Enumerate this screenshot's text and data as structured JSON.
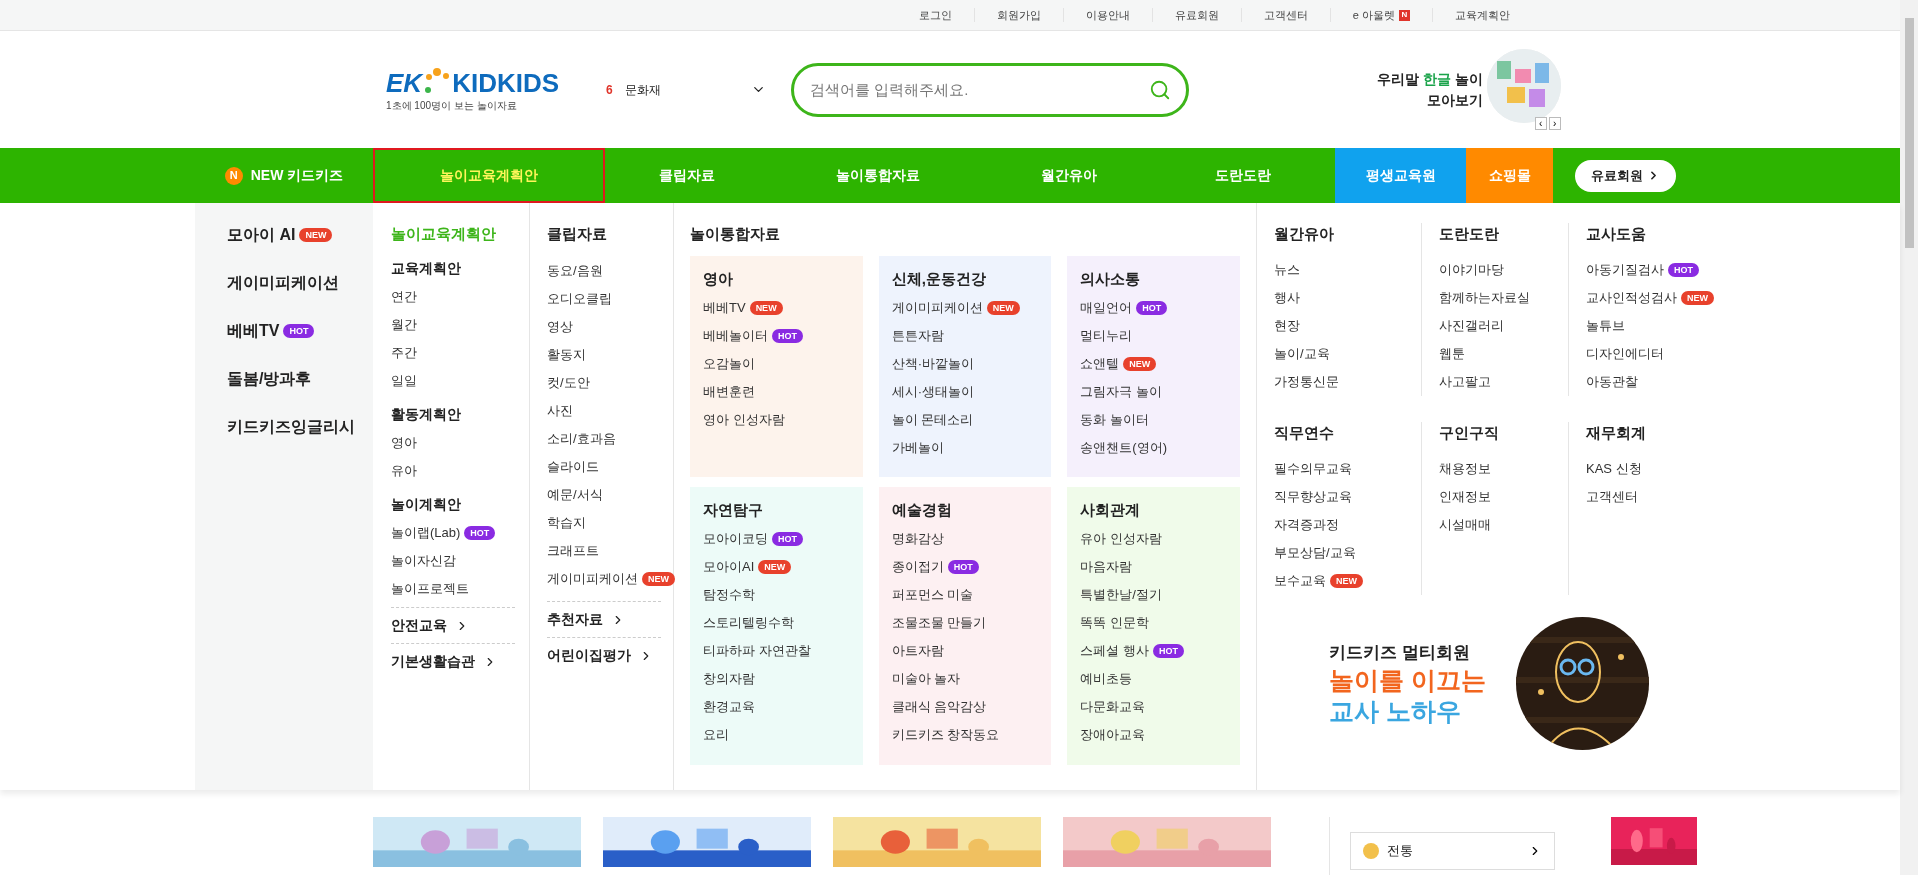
{
  "top_links": [
    {
      "label": "로그인"
    },
    {
      "label": "회원가입"
    },
    {
      "label": "이용안내"
    },
    {
      "label": "유료회원"
    },
    {
      "label": "고객센터"
    },
    {
      "label": "e 아울렛",
      "mark": "N"
    },
    {
      "label": "교육계획안"
    }
  ],
  "header": {
    "logo": {
      "prefix": "EK",
      "name": "KIDKIDS",
      "tagline": "1초에 100명이 보는 놀이자료"
    },
    "ranking": {
      "rank": "6",
      "keyword": "문화재"
    },
    "search": {
      "placeholder": "검색어를 입력해주세요."
    },
    "promo": {
      "before": "우리말",
      "highlight": "한글",
      "after": "놀이",
      "line2": "모아보기",
      "prev": "‹",
      "next": "›"
    }
  },
  "nav": [
    {
      "label": "NEW 키드키즈",
      "mark": "N",
      "kind": "plain",
      "selected": false
    },
    {
      "label": "놀이교육계획안",
      "kind": "plain",
      "selected": true
    },
    {
      "label": "클립자료",
      "kind": "plain",
      "selected": false
    },
    {
      "label": "놀이통합자료",
      "kind": "plain",
      "selected": false
    },
    {
      "label": "월간유아",
      "kind": "plain",
      "selected": false
    },
    {
      "label": "도란도란",
      "kind": "plain",
      "selected": false
    },
    {
      "label": "평생교육원",
      "kind": "blue",
      "selected": false
    },
    {
      "label": "쇼핑몰",
      "kind": "orange",
      "selected": false
    },
    {
      "label": "유료회원",
      "kind": "pill",
      "selected": false
    }
  ],
  "menu": {
    "side": [
      {
        "label": "모아이 AI",
        "badge": {
          "text": "NEW",
          "kind": "new"
        }
      },
      {
        "label": "게이미피케이션"
      },
      {
        "label": "베베TV",
        "badge": {
          "text": "HOT",
          "kind": "hot"
        }
      },
      {
        "label": "돌봄/방과후"
      },
      {
        "label": "키드키즈잉글리시"
      }
    ],
    "plan": {
      "title": "놀이교육계획안",
      "groups": [
        {
          "title": "교육계획안",
          "items": [
            {
              "label": "연간"
            },
            {
              "label": "월간"
            },
            {
              "label": "주간"
            },
            {
              "label": "일일"
            }
          ]
        },
        {
          "title": "활동계획안",
          "items": [
            {
              "label": "영아"
            },
            {
              "label": "유아"
            }
          ]
        },
        {
          "title": "놀이계획안",
          "items": [
            {
              "label": "놀이랩(Lab)",
              "badge": {
                "text": "HOT",
                "kind": "hot"
              }
            },
            {
              "label": "놀이자신감"
            },
            {
              "label": "놀이프로젝트"
            }
          ]
        }
      ],
      "links": [
        {
          "label": "안전교육"
        },
        {
          "label": "기본생활습관"
        }
      ]
    },
    "clips": {
      "title": "클립자료",
      "items": [
        {
          "label": "동요/음원"
        },
        {
          "label": "오디오클립"
        },
        {
          "label": "영상"
        },
        {
          "label": "활동지"
        },
        {
          "label": "컷/도안"
        },
        {
          "label": "사진"
        },
        {
          "label": "소리/효과음"
        },
        {
          "label": "슬라이드"
        },
        {
          "label": "예문/서식"
        },
        {
          "label": "학습지"
        },
        {
          "label": "크래프트"
        },
        {
          "label": "게이미피케이션",
          "badge": {
            "text": "NEW",
            "kind": "new"
          }
        }
      ],
      "links": [
        {
          "label": "추천자료"
        },
        {
          "label": "어린이집평가"
        }
      ]
    },
    "combined": {
      "title": "놀이통합자료",
      "boxes": [
        {
          "title": "영아",
          "color": "#fdf3ec",
          "items": [
            {
              "label": "베베TV",
              "badge": {
                "text": "NEW",
                "kind": "new"
              }
            },
            {
              "label": "베베놀이터",
              "badge": {
                "text": "HOT",
                "kind": "hot"
              }
            },
            {
              "label": "오감놀이"
            },
            {
              "label": "배변훈련"
            },
            {
              "label": "영아 인성자람"
            }
          ]
        },
        {
          "title": "신체,운동건강",
          "color": "#eef3fd",
          "items": [
            {
              "label": "게이미피케이션",
              "badge": {
                "text": "NEW",
                "kind": "new"
              }
            },
            {
              "label": "튼튼자람"
            },
            {
              "label": "산책·바깥놀이"
            },
            {
              "label": "세시·생태놀이"
            },
            {
              "label": "놀이 몬테소리"
            },
            {
              "label": "가베놀이"
            }
          ]
        },
        {
          "title": "의사소통",
          "color": "#f5f0fc",
          "items": [
            {
              "label": "매일언어",
              "badge": {
                "text": "HOT",
                "kind": "hot"
              }
            },
            {
              "label": "멀티누리"
            },
            {
              "label": "쇼앤텔",
              "badge": {
                "text": "NEW",
                "kind": "new"
              }
            },
            {
              "label": "그림자극 놀이"
            },
            {
              "label": "동화 놀이터"
            },
            {
              "label": "송앤챈트(영어)"
            }
          ]
        },
        {
          "title": "자연탐구",
          "color": "#edfbf8",
          "items": [
            {
              "label": "모아이코딩",
              "badge": {
                "text": "HOT",
                "kind": "hot"
              }
            },
            {
              "label": "모아이AI",
              "badge": {
                "text": "NEW",
                "kind": "new"
              }
            },
            {
              "label": "탐정수학"
            },
            {
              "label": "스토리텔링수학"
            },
            {
              "label": "티파하파 자연관찰"
            },
            {
              "label": "창의자람"
            },
            {
              "label": "환경교육"
            },
            {
              "label": "요리"
            }
          ]
        },
        {
          "title": "예술경험",
          "color": "#fdf0f2",
          "items": [
            {
              "label": "명화감상"
            },
            {
              "label": "종이접기",
              "badge": {
                "text": "HOT",
                "kind": "hot"
              }
            },
            {
              "label": "퍼포먼스 미술"
            },
            {
              "label": "조물조물 만들기"
            },
            {
              "label": "아트자람"
            },
            {
              "label": "미술아 놀자"
            },
            {
              "label": "클래식 음악감상"
            },
            {
              "label": "키드키즈 창작동요"
            }
          ]
        },
        {
          "title": "사회관계",
          "color": "#f0fbea",
          "items": [
            {
              "label": "유아 인성자람"
            },
            {
              "label": "마음자람"
            },
            {
              "label": "특별한날/절기"
            },
            {
              "label": "똑똑 인문학"
            },
            {
              "label": "스페셜 행사",
              "badge": {
                "text": "HOT",
                "kind": "hot"
              }
            },
            {
              "label": "예비초등"
            },
            {
              "label": "다문화교육"
            },
            {
              "label": "장애아교육"
            }
          ]
        }
      ]
    },
    "sections": [
      [
        {
          "title": "월간유아",
          "items": [
            {
              "label": "뉴스"
            },
            {
              "label": "행사"
            },
            {
              "label": "현장"
            },
            {
              "label": "놀이/교육"
            },
            {
              "label": "가정통신문"
            }
          ]
        },
        {
          "title": "도란도란",
          "items": [
            {
              "label": "이야기마당"
            },
            {
              "label": "함께하는자료실"
            },
            {
              "label": "사진갤러리"
            },
            {
              "label": "웹툰"
            },
            {
              "label": "사고팔고"
            }
          ]
        },
        {
          "title": "교사도움",
          "items": [
            {
              "label": "아동기질검사",
              "badge": {
                "text": "HOT",
                "kind": "hot"
              }
            },
            {
              "label": "교사인적성검사",
              "badge": {
                "text": "NEW",
                "kind": "new"
              }
            },
            {
              "label": "놀튜브"
            },
            {
              "label": "디자인에디터"
            },
            {
              "label": "아동관찰"
            }
          ]
        }
      ],
      [
        {
          "title": "직무연수",
          "items": [
            {
              "label": "필수의무교육"
            },
            {
              "label": "직무향상교육"
            },
            {
              "label": "자격증과정"
            },
            {
              "label": "부모상담/교육"
            },
            {
              "label": "보수교육",
              "badge": {
                "text": "NEW",
                "kind": "new"
              }
            }
          ]
        },
        {
          "title": "구인구직",
          "items": [
            {
              "label": "채용정보"
            },
            {
              "label": "인재정보"
            },
            {
              "label": "시설매매"
            }
          ]
        },
        {
          "title": "재무회계",
          "items": [
            {
              "label": "KAS 신청"
            },
            {
              "label": "고객센터"
            }
          ]
        }
      ]
    ],
    "banner": {
      "line1": "키드키즈 멀티회원",
      "line2": "놀이를 이끄는",
      "line3": "교사 노하우"
    }
  },
  "below": {
    "list_item": {
      "label": "전통"
    }
  }
}
